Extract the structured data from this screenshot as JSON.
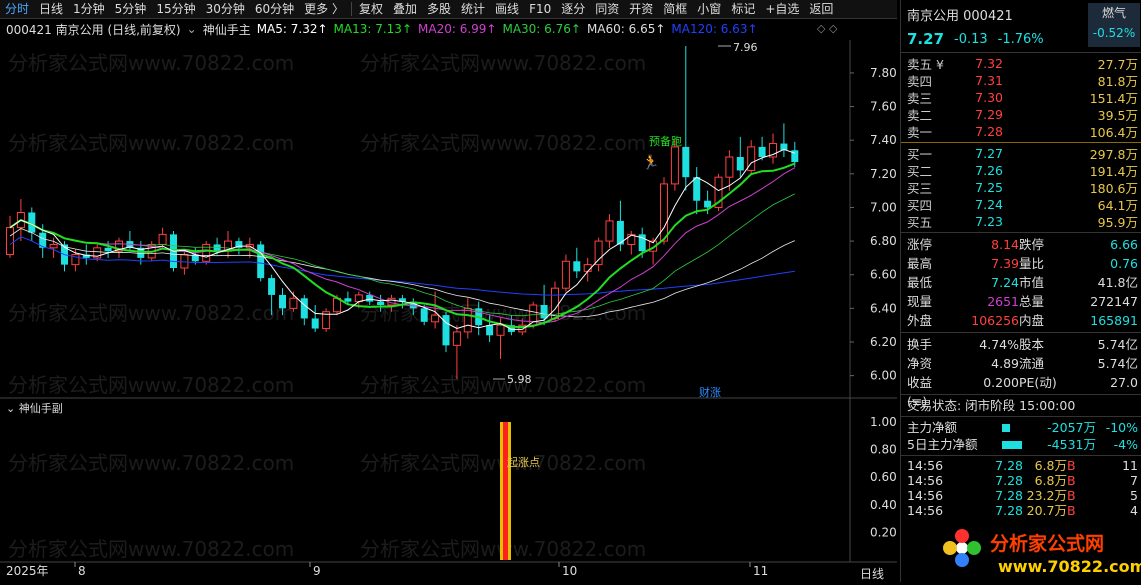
{
  "toolbar": {
    "items": [
      "分时",
      "日线",
      "1分钟",
      "5分钟",
      "15分钟",
      "30分钟",
      "60分钟",
      "更多 〉",
      "复权",
      "叠加",
      "多股",
      "统计",
      "画线",
      "F10",
      "逐分",
      "同资",
      "开资",
      "简框",
      "小窗",
      "标记",
      "+自选",
      "返回"
    ]
  },
  "main_header": {
    "code_name": "000421 南京公用 (日线,前复权)",
    "indicator": "神仙手主",
    "ma5": "MA5: 7.32↑",
    "ma13": "MA13: 7.13↑",
    "ma20": "MA20: 6.99↑",
    "ma30": "MA30: 6.76↑",
    "ma60": "MA60: 6.65↑",
    "ma120": "MA120: 6.63↑"
  },
  "sub_header": {
    "indicator": "神仙手副"
  },
  "annotations": {
    "high": "7.96",
    "low": "5.98",
    "yubeipao": "预备跑",
    "caizhang": "财涨",
    "qizhangdian": "起涨点"
  },
  "watermark": "分析家公式网www.70822.com",
  "axis": {
    "main_ticks": [
      "7.80",
      "7.60",
      "7.40",
      "7.20",
      "7.00",
      "6.80",
      "6.60",
      "6.40",
      "6.20",
      "6.00"
    ],
    "sub_ticks": [
      "1.00",
      "0.80",
      "0.60",
      "0.40",
      "0.20"
    ],
    "x_labels": [
      "2025年",
      "8",
      "9",
      "10",
      "11"
    ],
    "period": "日线"
  },
  "colors": {
    "up": "#ff4040",
    "down": "#1ee0e0",
    "ma5": "#ffffff",
    "ma13": "#22dd22",
    "ma20": "#d040d0",
    "ma30": "#2ecc40",
    "ma120": "#2040ff"
  },
  "panel": {
    "title": "南京公用 000421",
    "price": "7.27",
    "change": "-0.13",
    "pct": "-1.76%",
    "sector": "燃气",
    "sector_pct": "-0.52%",
    "asks": [
      {
        "label": "卖五 ¥",
        "price": "7.32",
        "vol": "27.7万"
      },
      {
        "label": "卖四",
        "price": "7.31",
        "vol": "81.8万"
      },
      {
        "label": "卖三",
        "price": "7.30",
        "vol": "151.4万"
      },
      {
        "label": "卖二",
        "price": "7.29",
        "vol": "39.5万"
      },
      {
        "label": "卖一",
        "price": "7.28",
        "vol": "106.4万"
      }
    ],
    "bids": [
      {
        "label": "买一",
        "price": "7.27",
        "vol": "297.8万"
      },
      {
        "label": "买二",
        "price": "7.26",
        "vol": "191.4万"
      },
      {
        "label": "买三",
        "price": "7.25",
        "vol": "180.6万"
      },
      {
        "label": "买四",
        "price": "7.24",
        "vol": "64.1万"
      },
      {
        "label": "买五",
        "price": "7.23",
        "vol": "95.9万"
      }
    ],
    "stats": [
      [
        "涨停",
        "8.14",
        "跌停",
        "6.66"
      ],
      [
        "最高",
        "7.39",
        "量比",
        "0.76"
      ],
      [
        "最低",
        "7.24",
        "市值",
        "41.8亿"
      ],
      [
        "现量",
        "2651",
        "总量",
        "272147"
      ],
      [
        "外盘",
        "106256",
        "内盘",
        "165891"
      ]
    ],
    "stats2": [
      [
        "换手",
        "4.74%",
        "股本",
        "5.74亿"
      ],
      [
        "净资",
        "4.89",
        "流通",
        "5.74亿"
      ],
      [
        "收益(≡)",
        "0.200",
        "PE(动)",
        "27.0"
      ]
    ],
    "trade_status": "交易状态: 闭市阶段 15:00:00",
    "flow1": {
      "label": "主力净额",
      "value": "-2057万",
      "pct": "-10%"
    },
    "flow2": {
      "label": "5日主力净额",
      "value": "-4531万",
      "pct": "-4%"
    },
    "ticks": [
      {
        "time": "14:56",
        "price": "7.28",
        "vol": "6.8万",
        "side": "B",
        "n": "11"
      },
      {
        "time": "14:56",
        "price": "7.28",
        "vol": "6.8万",
        "side": "B",
        "n": "7"
      },
      {
        "time": "14:56",
        "price": "7.28",
        "vol": "23.2万",
        "side": "B",
        "n": "5"
      },
      {
        "time": "14:56",
        "price": "7.28",
        "vol": "20.7万",
        "side": "B",
        "n": "4"
      }
    ],
    "logo_text": "分析家公式网",
    "logo_url": "www.70822.com"
  },
  "chart_data": {
    "type": "candlestick",
    "y_range": [
      5.9,
      7.98
    ],
    "candles": [
      [
        6.72,
        6.95,
        6.7,
        6.88
      ],
      [
        6.88,
        7.05,
        6.8,
        6.97
      ],
      [
        6.97,
        7.0,
        6.8,
        6.85
      ],
      [
        6.85,
        6.9,
        6.7,
        6.76
      ],
      [
        6.76,
        6.82,
        6.7,
        6.78
      ],
      [
        6.78,
        6.8,
        6.62,
        6.66
      ],
      [
        6.66,
        6.75,
        6.62,
        6.72
      ],
      [
        6.72,
        6.78,
        6.66,
        6.7
      ],
      [
        6.7,
        6.78,
        6.68,
        6.76
      ],
      [
        6.76,
        6.8,
        6.7,
        6.74
      ],
      [
        6.74,
        6.82,
        6.7,
        6.8
      ],
      [
        6.8,
        6.86,
        6.74,
        6.76
      ],
      [
        6.76,
        6.8,
        6.66,
        6.7
      ],
      [
        6.7,
        6.8,
        6.68,
        6.78
      ],
      [
        6.78,
        6.88,
        6.76,
        6.84
      ],
      [
        6.84,
        6.86,
        6.62,
        6.64
      ],
      [
        6.64,
        6.74,
        6.6,
        6.72
      ],
      [
        6.72,
        6.76,
        6.66,
        6.68
      ],
      [
        6.68,
        6.8,
        6.66,
        6.78
      ],
      [
        6.78,
        6.82,
        6.72,
        6.74
      ],
      [
        6.74,
        6.86,
        6.7,
        6.8
      ],
      [
        6.8,
        6.82,
        6.72,
        6.76
      ],
      [
        6.76,
        6.82,
        6.7,
        6.78
      ],
      [
        6.78,
        6.8,
        6.56,
        6.58
      ],
      [
        6.58,
        6.6,
        6.36,
        6.48
      ],
      [
        6.48,
        6.52,
        6.36,
        6.4
      ],
      [
        6.4,
        6.5,
        6.38,
        6.46
      ],
      [
        6.46,
        6.48,
        6.3,
        6.34
      ],
      [
        6.34,
        6.42,
        6.26,
        6.28
      ],
      [
        6.28,
        6.4,
        6.26,
        6.38
      ],
      [
        6.38,
        6.48,
        6.36,
        6.46
      ],
      [
        6.46,
        6.5,
        6.42,
        6.44
      ],
      [
        6.44,
        6.5,
        6.4,
        6.48
      ],
      [
        6.48,
        6.5,
        6.42,
        6.44
      ],
      [
        6.44,
        6.48,
        6.38,
        6.42
      ],
      [
        6.42,
        6.48,
        6.38,
        6.46
      ],
      [
        6.46,
        6.48,
        6.4,
        6.44
      ],
      [
        6.44,
        6.46,
        6.36,
        6.4
      ],
      [
        6.4,
        6.42,
        6.3,
        6.32
      ],
      [
        6.32,
        6.5,
        6.28,
        6.36
      ],
      [
        6.36,
        6.38,
        6.14,
        6.18
      ],
      [
        6.18,
        6.3,
        5.98,
        6.26
      ],
      [
        6.26,
        6.46,
        6.22,
        6.4
      ],
      [
        6.4,
        6.44,
        6.24,
        6.3
      ],
      [
        6.3,
        6.36,
        6.2,
        6.24
      ],
      [
        6.24,
        6.34,
        6.1,
        6.3
      ],
      [
        6.3,
        6.36,
        6.24,
        6.26
      ],
      [
        6.26,
        6.34,
        6.24,
        6.3
      ],
      [
        6.3,
        6.44,
        6.28,
        6.42
      ],
      [
        6.42,
        6.54,
        6.3,
        6.34
      ],
      [
        6.34,
        6.56,
        6.32,
        6.52
      ],
      [
        6.52,
        6.72,
        6.5,
        6.68
      ],
      [
        6.68,
        6.76,
        6.58,
        6.62
      ],
      [
        6.62,
        6.7,
        6.56,
        6.66
      ],
      [
        6.66,
        6.82,
        6.62,
        6.8
      ],
      [
        6.8,
        6.96,
        6.76,
        6.92
      ],
      [
        6.92,
        7.04,
        6.74,
        6.78
      ],
      [
        6.78,
        6.86,
        6.72,
        6.84
      ],
      [
        6.84,
        6.88,
        6.7,
        6.74
      ],
      [
        6.74,
        6.82,
        6.66,
        6.8
      ],
      [
        6.8,
        7.18,
        6.78,
        7.14
      ],
      [
        7.14,
        7.4,
        7.1,
        7.36
      ],
      [
        7.36,
        7.96,
        7.1,
        7.18
      ],
      [
        7.18,
        7.24,
        6.96,
        7.04
      ],
      [
        7.04,
        7.1,
        6.96,
        7.0
      ],
      [
        7.0,
        7.2,
        6.98,
        7.18
      ],
      [
        7.18,
        7.34,
        7.1,
        7.3
      ],
      [
        7.3,
        7.42,
        7.18,
        7.22
      ],
      [
        7.22,
        7.4,
        7.2,
        7.36
      ],
      [
        7.36,
        7.42,
        7.28,
        7.3
      ],
      [
        7.3,
        7.44,
        7.26,
        7.38
      ],
      [
        7.38,
        7.5,
        7.3,
        7.34
      ],
      [
        7.34,
        7.39,
        7.24,
        7.27
      ]
    ]
  }
}
